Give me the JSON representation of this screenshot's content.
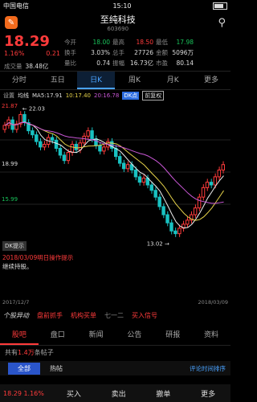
{
  "status": {
    "carrier": "中国电信",
    "time": "15:10"
  },
  "header": {
    "name": "至纯科技",
    "code": "603690",
    "logo_char": "✎",
    "search_icon": "⚲"
  },
  "quote": {
    "price": "18.29",
    "pct": "1.16%",
    "chg": "0.21",
    "rows": [
      [
        "今开",
        "18.00",
        "最高",
        "18.50",
        "最低",
        "17.98"
      ],
      [
        "换手",
        "3.03%",
        "总手",
        "27726",
        "金额",
        "5096万"
      ],
      [
        "量比",
        "0.74",
        "振幅",
        "16.73亿",
        "市盈",
        "80.14"
      ]
    ],
    "vol_k": "成交量",
    "vol_v": "38.48亿"
  },
  "tabs": [
    "分时",
    "五日",
    "日K",
    "周K",
    "月K",
    "更多"
  ],
  "indicator": {
    "gear": "设置",
    "mode": "均线",
    "ma5": "MA5:17.91",
    "ma10": "10:17.40",
    "ma20": "20:16.78",
    "dk": "DK点",
    "rfq": "前复权"
  },
  "chart_axis": {
    "high": "21.87",
    "mid": "18.99",
    "low": "15.99",
    "hi_mark": "22.03",
    "lo_mark": "13.02"
  },
  "chart_data": {
    "type": "candlestick",
    "x_start": "2017/12/7",
    "x_end": "2018/03/09",
    "y_range": [
      13.0,
      22.5
    ],
    "closes": [
      21.2,
      21.6,
      20.9,
      21.3,
      22.0,
      21.4,
      20.8,
      20.5,
      20.0,
      19.6,
      19.8,
      20.3,
      20.1,
      19.5,
      19.0,
      18.6,
      19.2,
      19.8,
      19.4,
      19.9,
      20.4,
      20.8,
      20.2,
      19.7,
      19.3,
      19.6,
      20.0,
      19.5,
      18.9,
      18.4,
      18.0,
      18.3,
      17.9,
      17.4,
      17.0,
      17.3,
      16.8,
      16.4,
      15.9,
      15.2,
      14.6,
      14.0,
      13.4,
      13.2,
      13.6,
      13.9,
      14.2,
      14.6,
      15.1,
      15.9,
      16.6,
      17.0,
      16.8,
      17.4,
      17.9,
      18.3
    ]
  },
  "dk_hint": "DK提示",
  "notice": {
    "date": "2018/03/09明日操作提示",
    "text": "继续持股。"
  },
  "dates": {
    "start": "2017/12/7",
    "end": "2018/03/09"
  },
  "promo": {
    "p1": "个股异动",
    "p2": "盘前抓手",
    "p3": "机构买单",
    "p4": "七一二",
    "p5": "买入信号"
  },
  "news_tabs": [
    "股吧",
    "盘口",
    "新闻",
    "公告",
    "研报",
    "资料"
  ],
  "forum": {
    "pre": "共有",
    "n": "1.4万",
    "post": "条帖子"
  },
  "forum_tabs": {
    "all": "全部",
    "hot": "热帖",
    "sort": "评论时间排序"
  },
  "bottom": {
    "price": "18.29 1.16%",
    "buy": "买入",
    "sell": "卖出",
    "cancel": "撤单",
    "more": "更多"
  }
}
